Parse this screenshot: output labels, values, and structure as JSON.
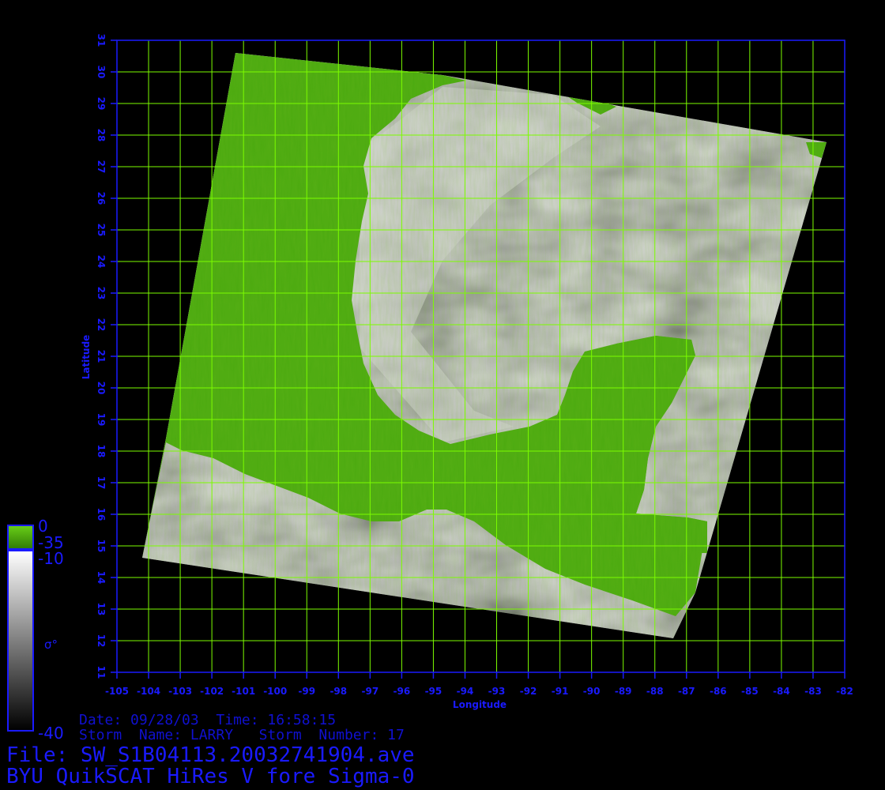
{
  "plot": {
    "xlabel": "Longitude",
    "ylabel": "Latitude",
    "lon_range": [
      -105,
      -82
    ],
    "lat_range": [
      11,
      31
    ],
    "lon_ticks": [
      "-105",
      "-104",
      "-103",
      "-102",
      "-101",
      "-100",
      "-99",
      "-98",
      "-97",
      "-96",
      "-95",
      "-94",
      "-93",
      "-92",
      "-91",
      "-90",
      "-89",
      "-88",
      "-87",
      "-86",
      "-85",
      "-84",
      "-83",
      "-82"
    ],
    "lat_ticks": [
      "11",
      "12",
      "13",
      "14",
      "15",
      "16",
      "17",
      "18",
      "19",
      "20",
      "21",
      "22",
      "23",
      "24",
      "25",
      "26",
      "27",
      "28",
      "29",
      "30",
      "31"
    ],
    "grid": true,
    "colors": {
      "axis": "#1a1aff",
      "grid": "#7cfc00",
      "land": "#4caa10",
      "background": "#000000"
    }
  },
  "colorbar": {
    "label": "σ°",
    "land_labels": [
      "0",
      "-35"
    ],
    "sigma_labels": [
      "-10",
      "-40"
    ]
  },
  "info": {
    "date_line": "Date: 09/28/03  Time: 16:58:15",
    "storm_line": "Storm  Name: LARRY   Storm  Number: 17",
    "file_line": "File: SW_S1B04113.20032741904.ave",
    "title_line": "BYU QuikSCAT HiRes V fore Sigma-0"
  }
}
